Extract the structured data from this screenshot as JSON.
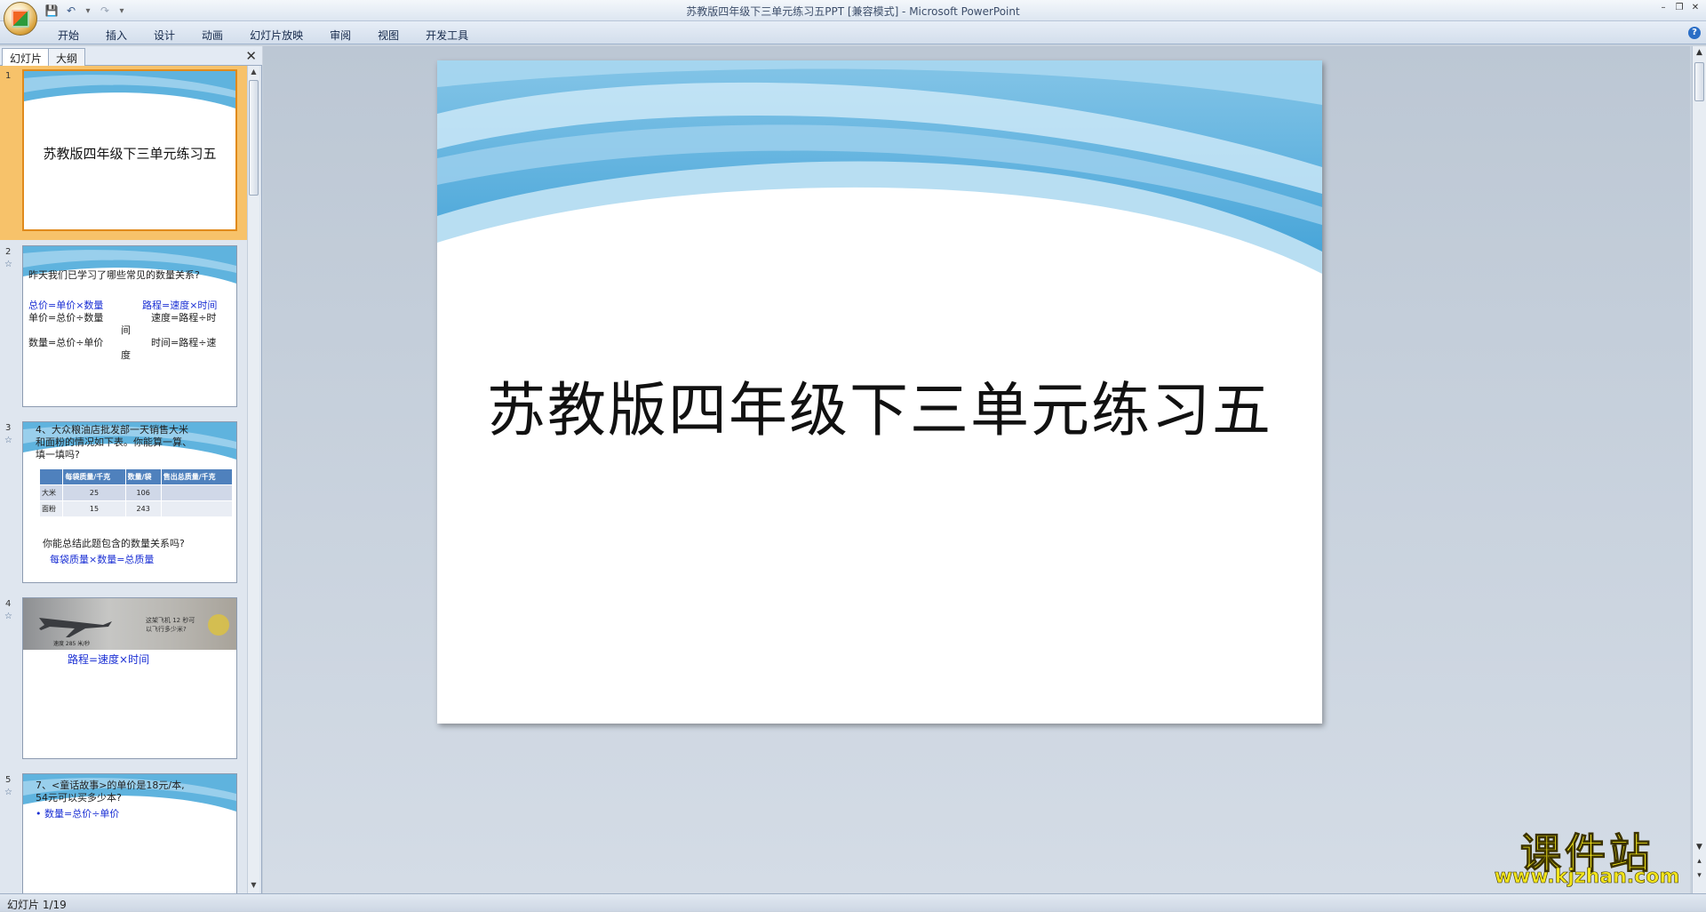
{
  "window": {
    "title": "苏教版四年级下三单元练习五PPT [兼容模式] - Microsoft PowerPoint"
  },
  "ribbon": {
    "tabs": [
      "开始",
      "插入",
      "设计",
      "动画",
      "幻灯片放映",
      "审阅",
      "视图",
      "开发工具"
    ]
  },
  "left_pane": {
    "tabs": {
      "slides": "幻灯片",
      "outline": "大纲"
    },
    "thumbnails": [
      {
        "number": "1",
        "title": "苏教版四年级下三单元练习五"
      },
      {
        "number": "2",
        "heading": "昨天我们已学习了哪些常见的数量关系?",
        "left_blue": "总价=单价×数量",
        "left_1": "单价=总价÷数量",
        "left_2": "数量=总价÷单价",
        "right_blue": "路程=速度×时间",
        "right_1": "速度=路程÷时",
        "mid_1": "间",
        "right_2": "时间=路程÷速",
        "mid_2": "度"
      },
      {
        "number": "3",
        "heading_1": "4、大众粮油店批发部一天销售大米",
        "heading_2": "和面粉的情况如下表。你能算一算、",
        "heading_3": "填一填吗?",
        "table_head": [
          "",
          "每袋质量/千克",
          "数量/袋",
          "售出总质量/千克"
        ],
        "row1": [
          "大米",
          "25",
          "106",
          ""
        ],
        "row2": [
          "面粉",
          "15",
          "243",
          ""
        ],
        "question": "你能总结此题包含的数量关系吗?",
        "answer": "每袋质量×数量=总质量"
      },
      {
        "number": "4",
        "photo_text_1": "这架飞机 12 秒可",
        "photo_text_2": "以飞行多少米?",
        "photo_speed": "速度 285 米/秒",
        "formula": "路程=速度×时间"
      },
      {
        "number": "5",
        "heading_1": "7、<童话故事>的单价是18元/本,",
        "heading_2": "54元可以买多少本?",
        "bullet": "• 数量=总价÷单价"
      }
    ]
  },
  "slide": {
    "title": "苏教版四年级下三单元练习五"
  },
  "statusbar": {
    "text": "幻灯片 1/19"
  },
  "watermark": {
    "chinese": "课件站",
    "url": "www.kjzhan.com"
  }
}
